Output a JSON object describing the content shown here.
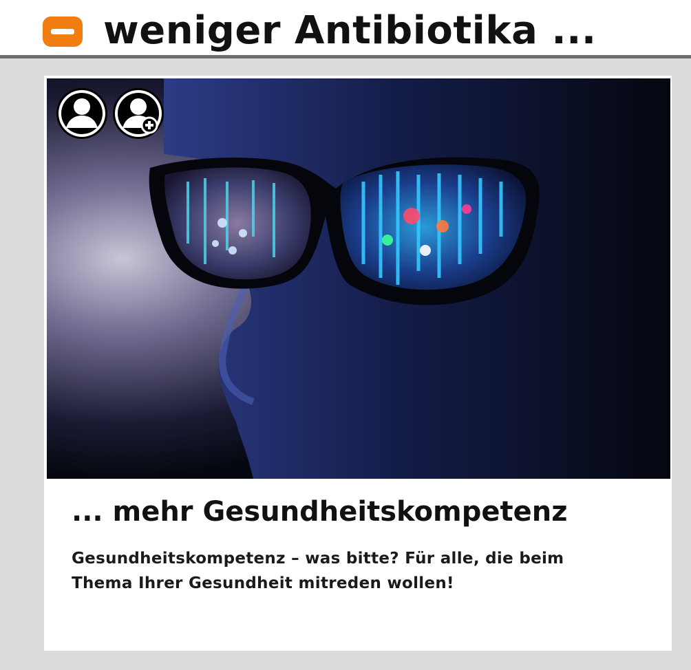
{
  "header": {
    "icon": "orange-minus-badge-icon",
    "accent": "#f07d0f",
    "title": "weniger Antibiotika ..."
  },
  "card": {
    "image_alt": "",
    "icons": [
      "user-profile-icon",
      "add-user-icon"
    ],
    "title": "... mehr Gesundheitskompetenz",
    "text": "Gesundheitskompetenz – was bitte? Für alle, die beim Thema Ihrer Gesundheit mitreden wollen!"
  }
}
